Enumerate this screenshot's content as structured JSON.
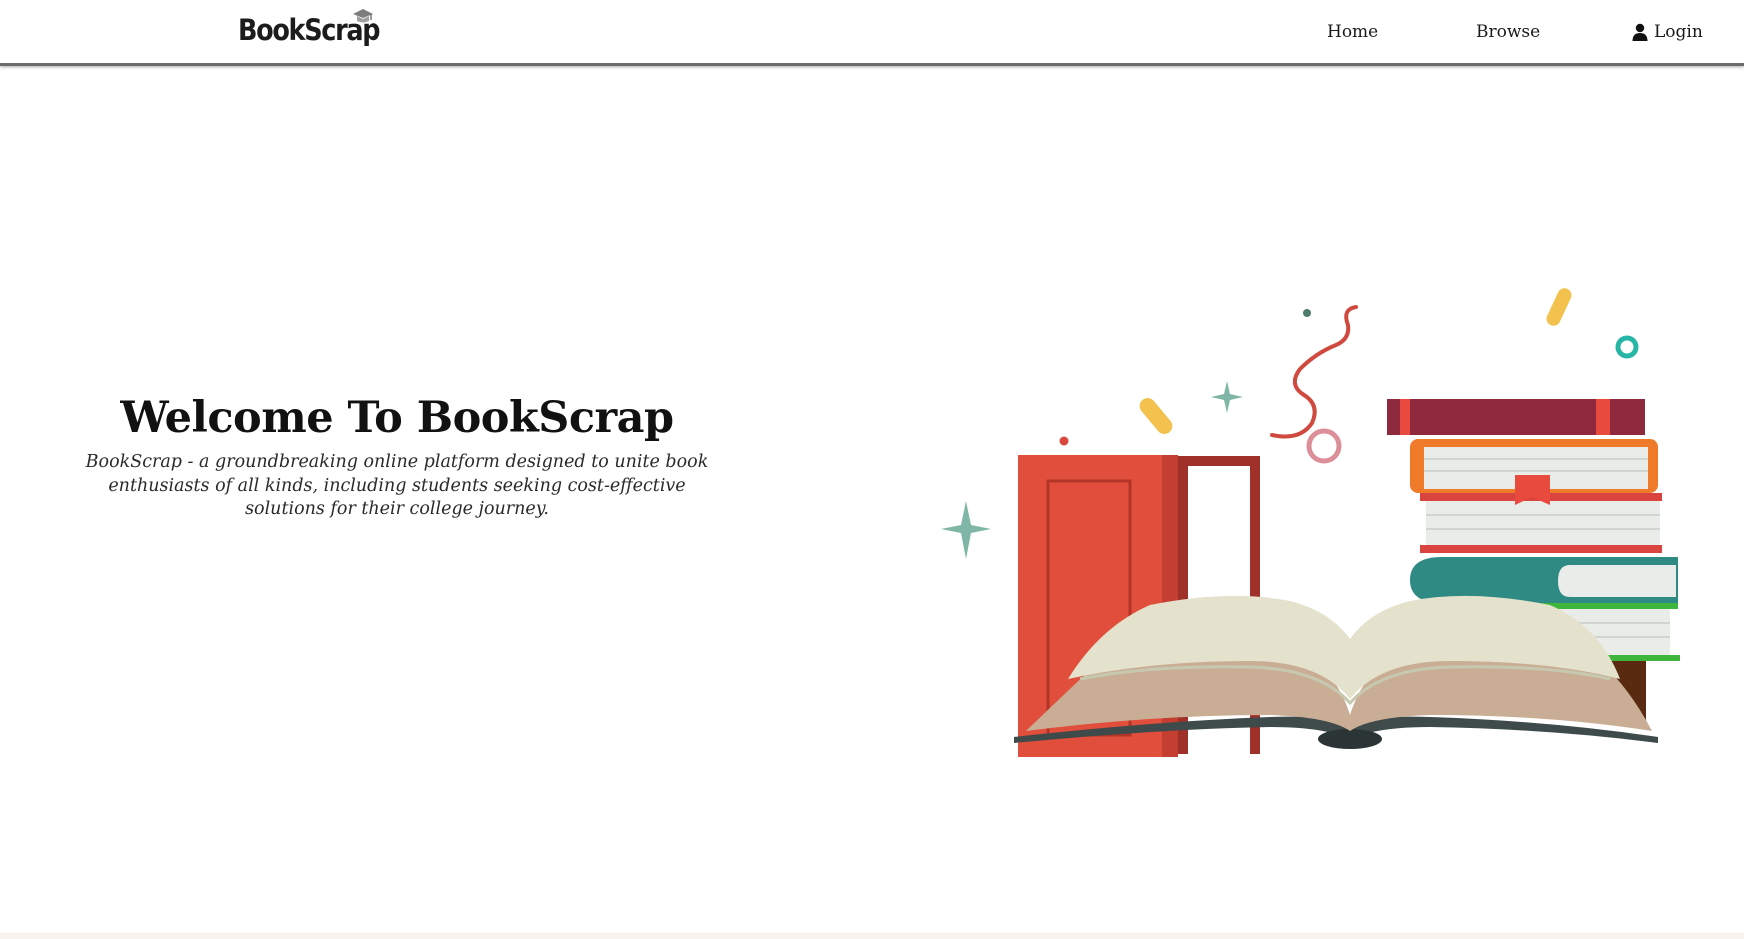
{
  "brand": {
    "name": "BookScrap",
    "logo_icon": "graduation-hat-icon"
  },
  "nav": {
    "home": "Home",
    "browse": "Browse",
    "login": "Login",
    "login_icon": "user-icon"
  },
  "hero": {
    "title": "Welcome To BookScrap",
    "description": "BookScrap - a groundbreaking online platform designed to unite book enthusiasts of all kinds, including students seeking cost-effective solutions for their college journey.",
    "illustration": "open-book-door-illustration"
  },
  "colors": {
    "door_red": "#e24e3c",
    "teal": "#2f8a84",
    "accent_yellow": "#f2c14e",
    "book_maroon": "#8f2a3e",
    "orange": "#ee7a2a",
    "green": "#3eb53b",
    "page_cream": "#e4e2cc",
    "nav_border": "#6b6b6b"
  }
}
